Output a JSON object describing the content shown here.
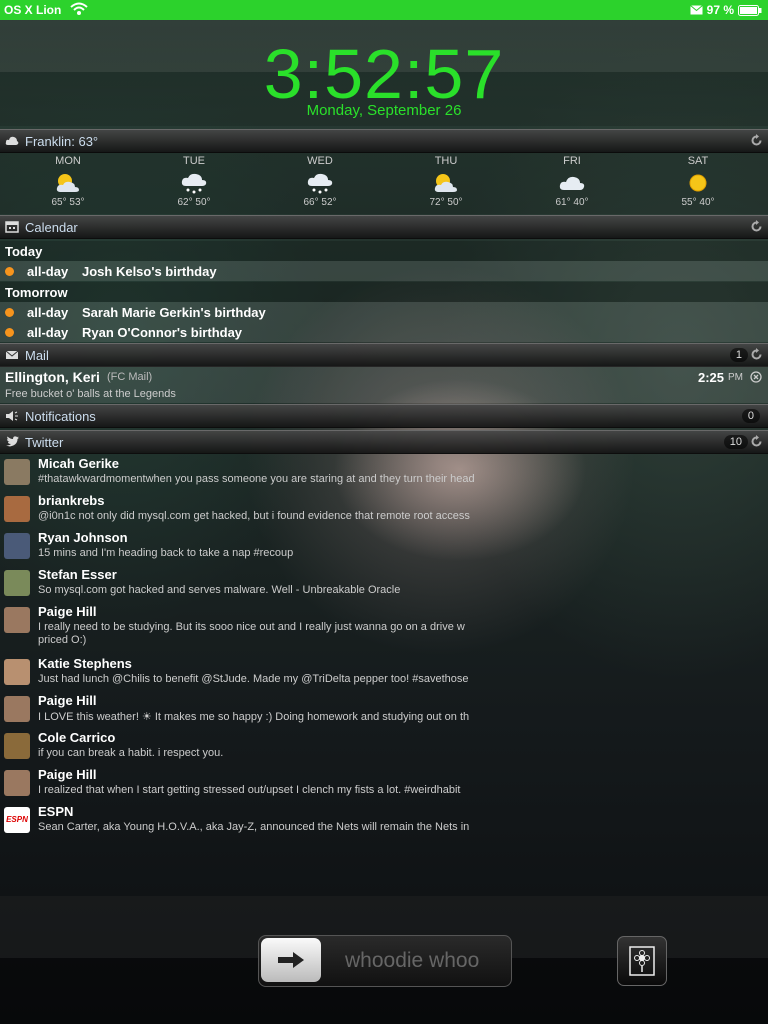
{
  "status_bar": {
    "carrier": "OS X Lion",
    "battery": "97 %"
  },
  "clock": {
    "time": "3:52:57",
    "date": "Monday, September 26",
    "accent": "#2ae02a"
  },
  "weather": {
    "title": "Franklin: 63°",
    "days": [
      {
        "name": "MON",
        "temps": "65° 53°",
        "icon": "partly-sunny-icon"
      },
      {
        "name": "TUE",
        "temps": "62° 50°",
        "icon": "snow-cloud-icon"
      },
      {
        "name": "WED",
        "temps": "66° 52°",
        "icon": "snow-cloud-icon"
      },
      {
        "name": "THU",
        "temps": "72° 50°",
        "icon": "partly-sunny-icon"
      },
      {
        "name": "FRI",
        "temps": "61° 40°",
        "icon": "cloud-icon"
      },
      {
        "name": "SAT",
        "temps": "55° 40°",
        "icon": "sun-icon"
      }
    ]
  },
  "calendar": {
    "title": "Calendar",
    "groups": [
      {
        "label": "Today",
        "events": [
          {
            "time": "all-day",
            "title": "Josh Kelso's birthday"
          }
        ]
      },
      {
        "label": "Tomorrow",
        "events": [
          {
            "time": "all-day",
            "title": "Sarah Marie Gerkin's birthday"
          },
          {
            "time": "all-day",
            "title": "Ryan O'Connor's birthday"
          }
        ]
      }
    ]
  },
  "mail": {
    "title": "Mail",
    "count": "1",
    "sender": "Ellington, Keri",
    "account": "(FC Mail)",
    "subject": "Free bucket o' balls at the Legends",
    "time": "2:25",
    "ampm": "PM"
  },
  "notifications": {
    "title": "Notifications",
    "count": "0"
  },
  "twitter": {
    "title": "Twitter",
    "count": "10",
    "tweets": [
      {
        "name": "Micah Gerike",
        "text": "#thatawkwardmomentwhen you pass someone you are staring at and they turn their head",
        "text2": "",
        "avatar": "#8a7a62"
      },
      {
        "name": "briankrebs",
        "text": "@i0n1c not only did mysql.com get hacked, but i found evidence  that remote root access",
        "text2": "",
        "avatar": "#a86a40"
      },
      {
        "name": "Ryan Johnson",
        "text": "15 mins and I'm heading back to take a nap #recoup",
        "text2": "",
        "avatar": "#4a5a78"
      },
      {
        "name": "Stefan Esser",
        "text": "So mysql.com got hacked and serves malware. Well - Unbreakable Oracle",
        "text2": "",
        "avatar": "#7a8a5a"
      },
      {
        "name": "Paige Hill",
        "text": "I really need to be studying. But its sooo nice out and I really just wanna go on a drive w",
        "text2": "priced O:)",
        "avatar": "#9a7860"
      },
      {
        "name": "Katie Stephens",
        "text": "Just had lunch @Chilis to benefit @StJude. Made my @TriDelta pepper too! #savethose",
        "text2": "",
        "avatar": "#b89070"
      },
      {
        "name": "Paige Hill",
        "text": "I LOVE this weather! ☀ It makes me so happy :) Doing homework and studying out on th",
        "text2": "",
        "avatar": "#9a7860"
      },
      {
        "name": "Cole Carrico",
        "text": "if you can break a habit. i respect you.",
        "text2": "",
        "avatar": "#8a6a3a"
      },
      {
        "name": "Paige Hill",
        "text": "I realized that when I start getting stressed out/upset I clench my fists a lot. #weirdhabit",
        "text2": "",
        "avatar": "#9a7860"
      },
      {
        "name": "ESPN",
        "text": "Sean Carter, aka Young H.O.V.A., aka Jay-Z, announced the Nets will remain the Nets in",
        "text2": "",
        "avatar": "#ffffff",
        "logo": "ESPN"
      }
    ]
  },
  "lock": {
    "slide_text": "whoodie whoo"
  }
}
